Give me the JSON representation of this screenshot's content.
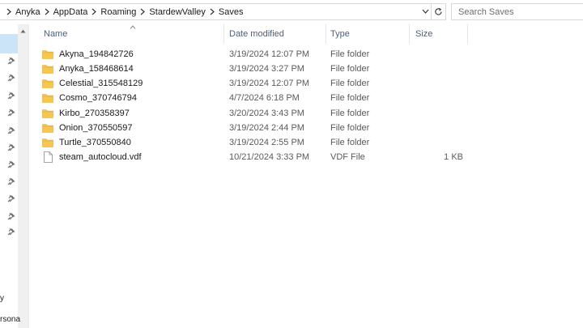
{
  "address": {
    "breadcrumbs": [
      "Anyka",
      "AppData",
      "Roaming",
      "StardewValley",
      "Saves"
    ]
  },
  "search": {
    "placeholder": "Search Saves"
  },
  "nav_pane": {
    "labels": [
      "y",
      "rsona"
    ]
  },
  "columns": {
    "name": "Name",
    "date_modified": "Date modified",
    "type": "Type",
    "size": "Size"
  },
  "files": [
    {
      "name": "Akyna_194842726",
      "date": "3/19/2024 12:07 PM",
      "type": "File folder",
      "size": "",
      "icon": "folder-icon"
    },
    {
      "name": "Anyka_158468614",
      "date": "3/19/2024 3:27 PM",
      "type": "File folder",
      "size": "",
      "icon": "folder-icon"
    },
    {
      "name": "Celestial_315548129",
      "date": "3/19/2024 12:07 PM",
      "type": "File folder",
      "size": "",
      "icon": "folder-icon"
    },
    {
      "name": "Cosmo_370746794",
      "date": "4/7/2024 6:18 PM",
      "type": "File folder",
      "size": "",
      "icon": "folder-icon"
    },
    {
      "name": "Kirbo_270358397",
      "date": "3/20/2024 3:43 PM",
      "type": "File folder",
      "size": "",
      "icon": "folder-icon"
    },
    {
      "name": "Onion_370550597",
      "date": "3/19/2024 2:44 PM",
      "type": "File folder",
      "size": "",
      "icon": "folder-icon"
    },
    {
      "name": "Turtle_370550840",
      "date": "3/19/2024 2:55 PM",
      "type": "File folder",
      "size": "",
      "icon": "folder-icon"
    },
    {
      "name": "steam_autocloud.vdf",
      "date": "10/21/2024 3:33 PM",
      "type": "VDF File",
      "size": "1 KB",
      "icon": "file-icon"
    }
  ],
  "colors": {
    "folder": "#f6c74f",
    "folder_dark": "#e2a93a",
    "header_text": "#4c607a",
    "selection": "#cce4f7"
  }
}
